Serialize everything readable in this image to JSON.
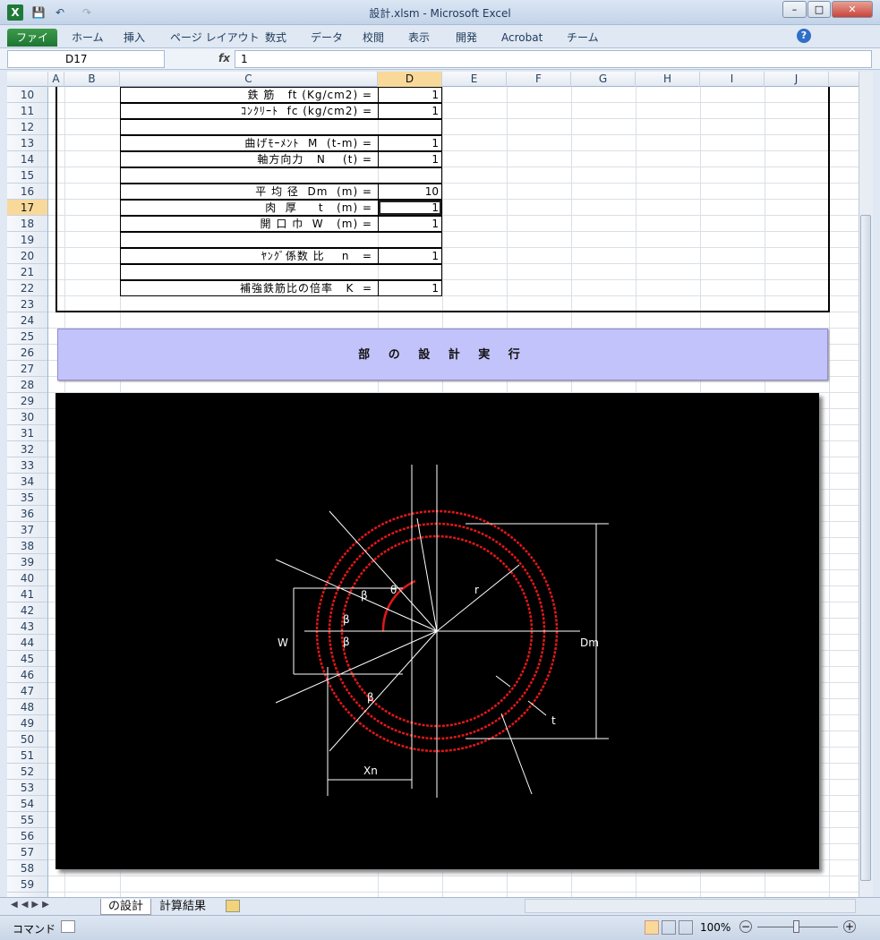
{
  "window": {
    "app_icon": "X",
    "title": "設計.xlsm  -  Microsoft Excel",
    "min": "–",
    "max": "□",
    "close": "✕",
    "qa_save": "💾",
    "qa_undo": "↶",
    "qa_redo": "↷"
  },
  "ribbon": {
    "tabs": [
      "ファイル",
      "ホーム",
      "挿入",
      "ページ レイアウト",
      "数式",
      "データ",
      "校閲",
      "表示",
      "開発",
      "Acrobat",
      "チーム"
    ],
    "help": "?"
  },
  "formula_bar": {
    "name_box": "D17",
    "fx": "fx",
    "value": "1"
  },
  "columns": [
    "A",
    "B",
    "C",
    "D",
    "E",
    "F",
    "G",
    "H",
    "I",
    "J"
  ],
  "selected_column": "D",
  "rows": [
    "10",
    "11",
    "12",
    "13",
    "14",
    "15",
    "16",
    "17",
    "18",
    "19",
    "20",
    "21",
    "22",
    "23",
    "24",
    "25",
    "26",
    "27",
    "28",
    "29",
    "30",
    "31",
    "32",
    "33",
    "34",
    "35",
    "36",
    "37",
    "38",
    "39",
    "40",
    "41",
    "42",
    "43",
    "44",
    "45",
    "46",
    "47",
    "48",
    "49",
    "50",
    "51",
    "52",
    "53",
    "54",
    "55",
    "56",
    "57",
    "58",
    "59"
  ],
  "selected_row": "17",
  "params": [
    {
      "row": "10",
      "label": "鉄 筋   ft (Kg/cm2) =",
      "value": "1"
    },
    {
      "row": "11",
      "label": "ｺﾝｸﾘｰﾄ  fc (kg/cm2) =",
      "value": "1"
    },
    {
      "row": "12",
      "label": "",
      "value": ""
    },
    {
      "row": "13",
      "label": "曲げﾓｰﾒﾝﾄ  M  (t-m) =",
      "value": "1"
    },
    {
      "row": "14",
      "label": "軸方向力   N    (t) =",
      "value": "1"
    },
    {
      "row": "15",
      "label": "",
      "value": ""
    },
    {
      "row": "16",
      "label": "平 均 径  Dm  (m) =",
      "value": "10"
    },
    {
      "row": "17",
      "label": "肉  厚     t   (m) =",
      "value": "1"
    },
    {
      "row": "18",
      "label": "開 口 巾  W   (m) =",
      "value": "1"
    },
    {
      "row": "19",
      "label": "",
      "value": ""
    },
    {
      "row": "20",
      "label": "ﾔﾝｸﾞ係数 比    n   =",
      "value": "1"
    },
    {
      "row": "21",
      "label": "",
      "value": ""
    },
    {
      "row": "22",
      "label": "補強鉄筋比の倍率   K  =",
      "value": "1"
    }
  ],
  "run_button": "部 の 設 計 実 行",
  "diagram": {
    "labels": {
      "r": "r",
      "theta": "θ",
      "beta": "β",
      "w": "W",
      "dm": "Dm",
      "t": "t",
      "xn": "Xn"
    },
    "circle_color": "#e01818",
    "line_color": "#ffffff"
  },
  "sheet_tabs": [
    "の設計",
    "計算結果"
  ],
  "status": {
    "mode": "コマンド",
    "zoom": "100%"
  }
}
